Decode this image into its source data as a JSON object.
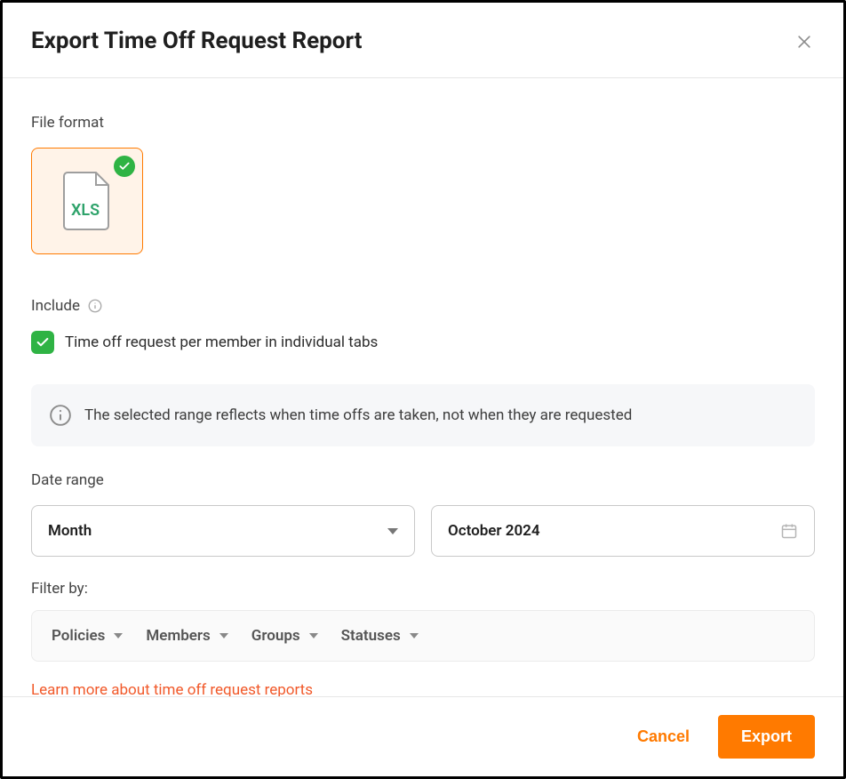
{
  "header": {
    "title": "Export Time Off Request Report"
  },
  "file_format": {
    "label": "File format",
    "option_label": "XLS",
    "selected": true
  },
  "include": {
    "label": "Include",
    "checkbox_label": "Time off request per member in individual tabs",
    "checked": true
  },
  "info_banner": {
    "text": "The selected range reflects when time offs are taken, not when they are requested"
  },
  "date_range": {
    "label": "Date range",
    "unit": "Month",
    "value": "October 2024"
  },
  "filter_by": {
    "label": "Filter by:",
    "items": [
      "Policies",
      "Members",
      "Groups",
      "Statuses"
    ]
  },
  "learn_more": {
    "text": "Learn more about time off request reports"
  },
  "footer": {
    "cancel": "Cancel",
    "export": "Export"
  }
}
